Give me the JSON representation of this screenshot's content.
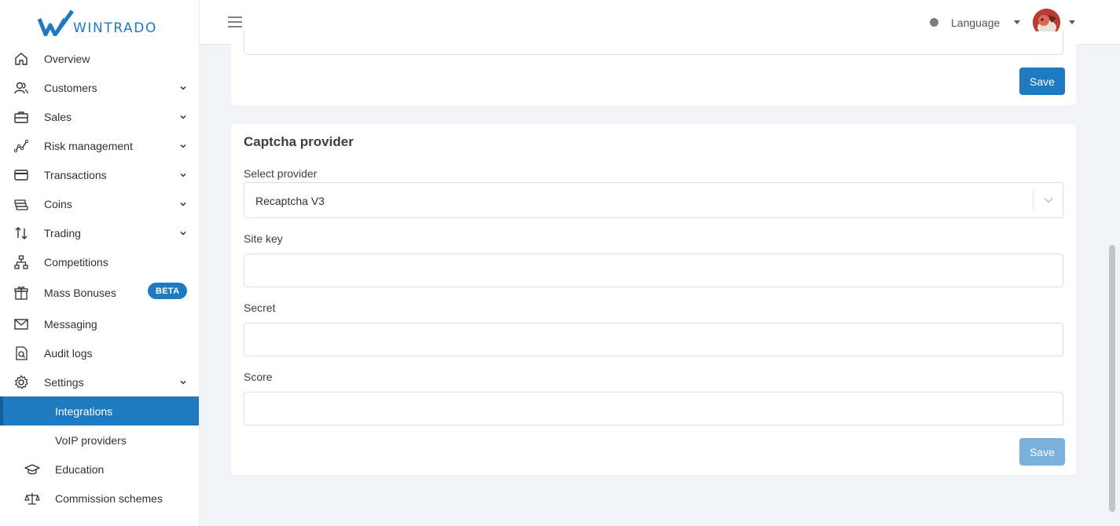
{
  "brand": {
    "name": "WINTRADO"
  },
  "sidebar": {
    "items": [
      {
        "label": "Overview",
        "icon": "home-icon"
      },
      {
        "label": "Customers",
        "icon": "users-icon"
      },
      {
        "label": "Sales",
        "icon": "briefcase-icon"
      },
      {
        "label": "Risk management",
        "icon": "chart-line-icon"
      },
      {
        "label": "Transactions",
        "icon": "credit-card-icon"
      },
      {
        "label": "Coins",
        "icon": "coins-icon"
      },
      {
        "label": "Trading",
        "icon": "arrows-up-down-icon"
      },
      {
        "label": "Competitions",
        "icon": "sitemap-icon"
      },
      {
        "label": "Mass Bonuses",
        "icon": "gift-icon",
        "badge": "BETA"
      },
      {
        "label": "Messaging",
        "icon": "envelope-icon"
      },
      {
        "label": "Audit logs",
        "icon": "file-search-icon"
      },
      {
        "label": "Settings",
        "icon": "gear-icon"
      },
      {
        "label": "Integrations"
      },
      {
        "label": "VoIP providers"
      },
      {
        "label": "Education",
        "icon": "graduation-cap-icon"
      },
      {
        "label": "Commission schemes",
        "icon": "scale-icon"
      }
    ]
  },
  "header": {
    "language_label": "Language",
    "status_color": "#7a7d82"
  },
  "previous_card": {
    "save_label": "Save"
  },
  "captcha": {
    "title": "Captcha provider",
    "provider_label": "Select provider",
    "provider_value": "Recaptcha V3",
    "site_key_label": "Site key",
    "site_key_value": "",
    "secret_label": "Secret",
    "secret_value": "",
    "score_label": "Score",
    "score_value": "",
    "save_label": "Save"
  },
  "colors": {
    "accent": "#1f7bc1",
    "accent_disabled": "#79b1dc",
    "background": "#f2f3f6"
  }
}
